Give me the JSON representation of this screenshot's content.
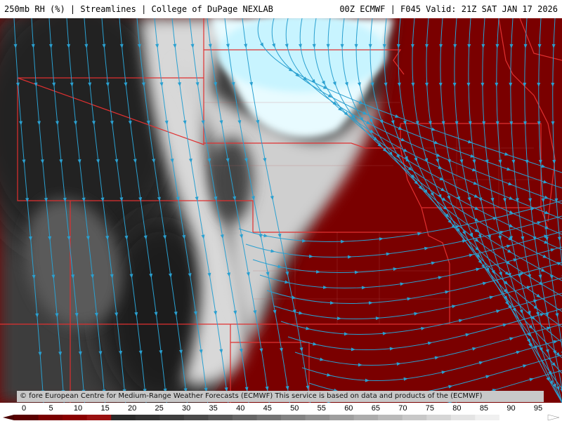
{
  "header": {
    "left_title": "250mb RH (%) | Streamlines | College of DuPage NEXLAB",
    "right_title": "00Z ECMWF | F045 Valid: 21Z SAT JAN 17 2026"
  },
  "map": {
    "field": "250mb RH",
    "overlay": "Streamlines",
    "border_color": "#e03030",
    "streamline_color": "#2aa0d0",
    "dry_color": "#7a0000",
    "moist_color": "#ffffff",
    "saturated_color": "#c8f4ff"
  },
  "credits": {
    "text": "© fore European Centre for Medium-Range Weather Forecasts (ECMWF) This service is based on data and products of the (ECMWF)"
  },
  "colorbar": {
    "ticks": [
      "0",
      "5",
      "10",
      "15",
      "20",
      "25",
      "30",
      "35",
      "40",
      "45",
      "50",
      "55",
      "60",
      "65",
      "70",
      "75",
      "80",
      "85",
      "90",
      "95"
    ]
  }
}
